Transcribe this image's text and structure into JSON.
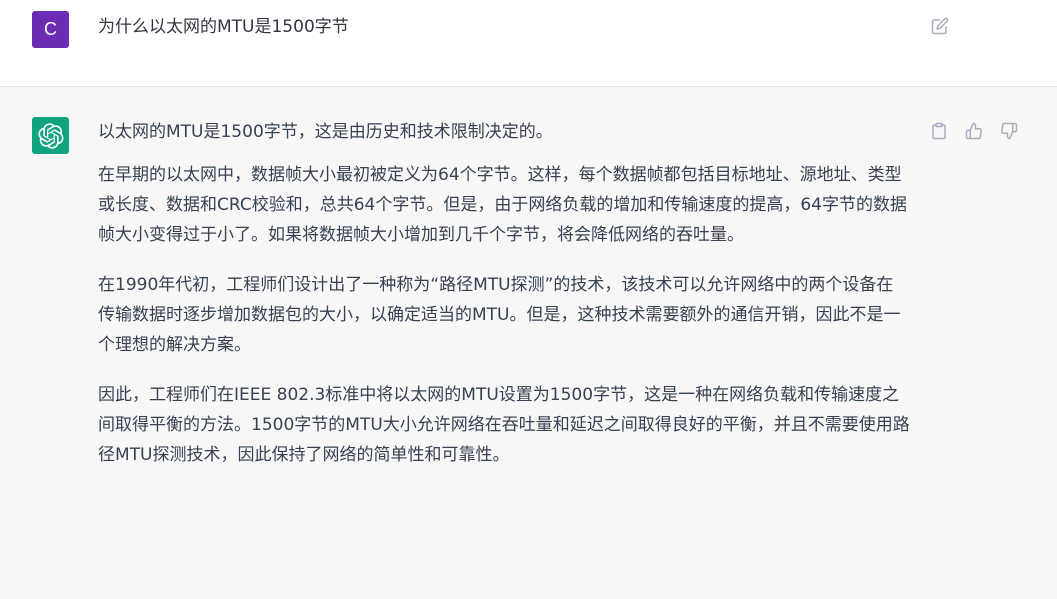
{
  "user_message": {
    "avatar_letter": "C",
    "avatar_color": "#6e2bb3",
    "text": "为什么以太网的MTU是1500字节",
    "edit_icon": "edit-icon"
  },
  "assistant_message": {
    "avatar_icon": "openai-logo-icon",
    "avatar_color": "#10a37f",
    "intro": "以太网的MTU是1500字节，这是由历史和技术限制决定的。",
    "paragraphs": [
      "在早期的以太网中，数据帧大小最初被定义为64个字节。这样，每个数据帧都包括目标地址、源地址、类型或长度、数据和CRC校验和，总共64个字节。但是，由于网络负载的增加和传输速度的提高，64字节的数据帧大小变得过于小了。如果将数据帧大小增加到几千个字节，将会降低网络的吞吐量。",
      "在1990年代初，工程师们设计出了一种称为“路径MTU探测”的技术，该技术可以允许网络中的两个设备在传输数据时逐步增加数据包的大小，以确定适当的MTU。但是，这种技术需要额外的通信开销，因此不是一个理想的解决方案。",
      "因此，工程师们在IEEE 802.3标准中将以太网的MTU设置为1500字节，这是一种在网络负载和传输速度之间取得平衡的方法。1500字节的MTU大小允许网络在吞吐量和延迟之间取得良好的平衡，并且不需要使用路径MTU探测技术，因此保持了网络的简单性和可靠性。"
    ],
    "action_icons": [
      "copy-icon",
      "thumbs-up-icon",
      "thumbs-down-icon"
    ]
  },
  "colors": {
    "assistant_bg": "#f7f7f8",
    "text": "#374151",
    "icon": "#acacbe"
  }
}
